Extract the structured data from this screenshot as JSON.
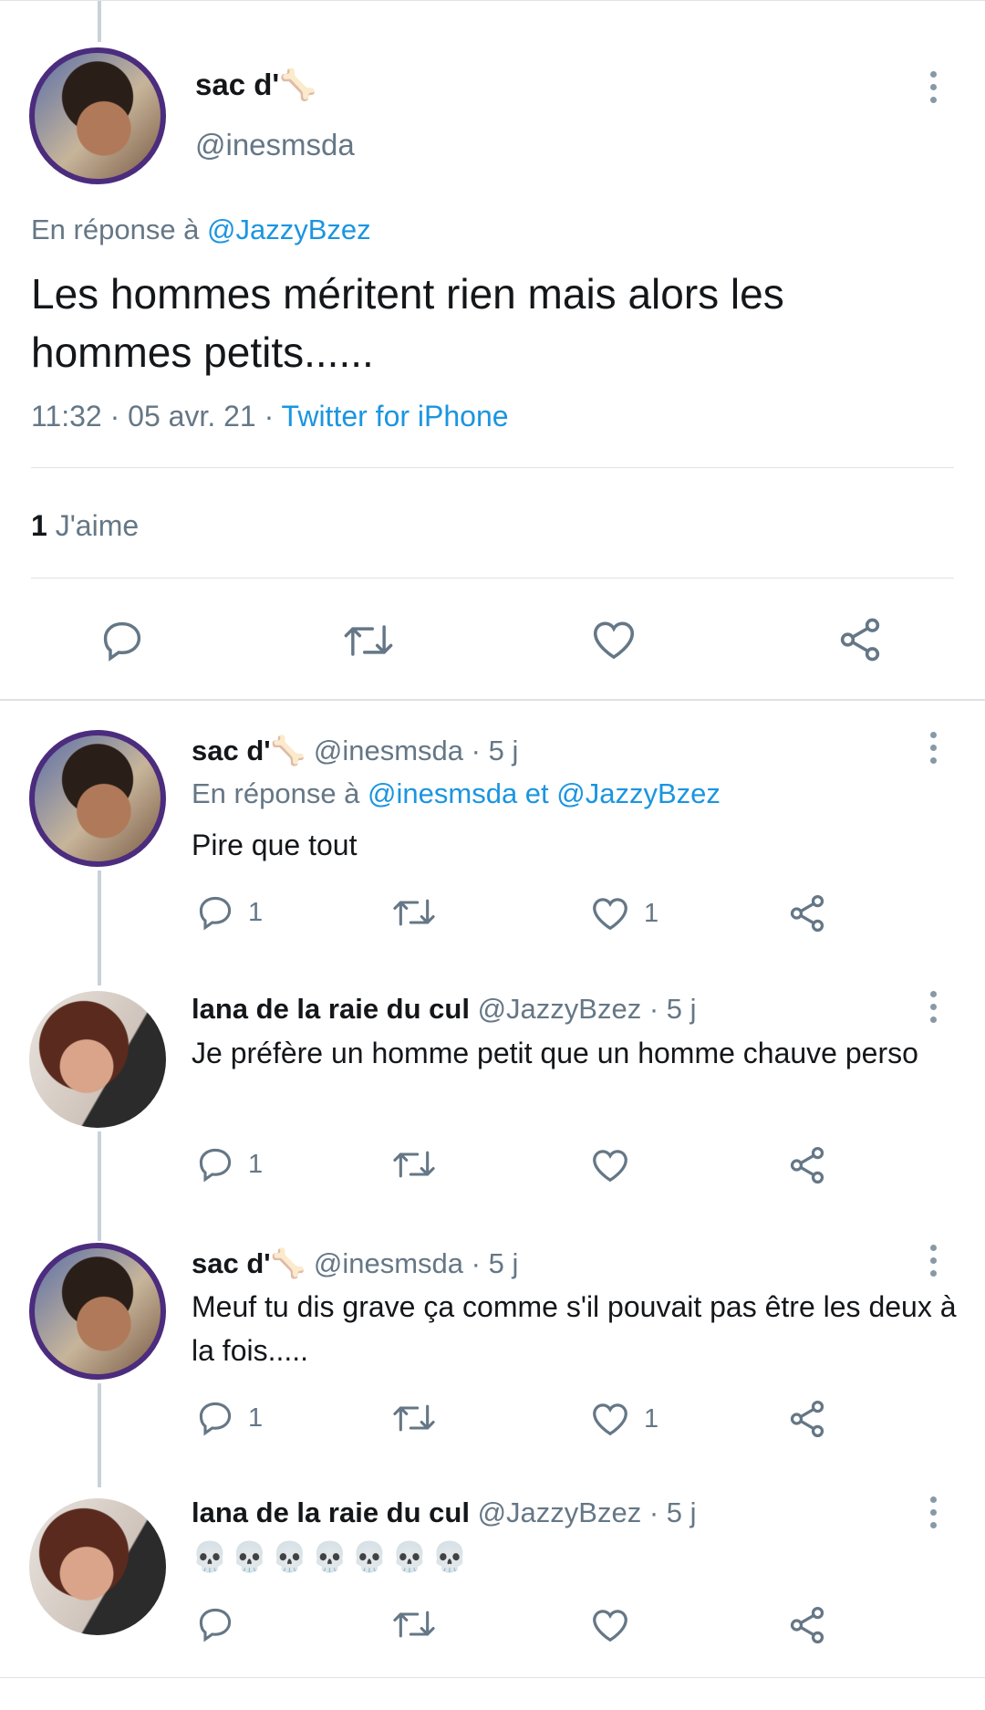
{
  "main_tweet": {
    "name": "sac d'",
    "name_emoji": "🦴",
    "handle": "@inesmsda",
    "reply_prefix": "En réponse à",
    "reply_to": "@JazzyBzez",
    "text": "Les hommes méritent rien mais alors les hommes petits......",
    "time_date": "11:32 · 05 avr. 21 ·",
    "source": "Twitter for iPhone",
    "likes_count": "1",
    "likes_label": "J'aime"
  },
  "replies": [
    {
      "name": "sac d'",
      "name_emoji": "🦴",
      "handle": "@inesmsda",
      "time": "· 5 j",
      "reply_prefix": "En réponse à",
      "reply_to": "@inesmsda et @JazzyBzez",
      "text": "Pire que tout",
      "reply_count": "1",
      "retweet_count": "",
      "like_count": "1"
    },
    {
      "name": "lana de la raie du cul",
      "name_emoji": "",
      "handle": "@JazzyBzez",
      "time": "· 5 j",
      "text": "Je préfère un homme petit que un homme chauve perso",
      "reply_count": "1",
      "retweet_count": "",
      "like_count": ""
    },
    {
      "name": "sac d'",
      "name_emoji": "🦴",
      "handle": "@inesmsda",
      "time": "· 5 j",
      "text": "Meuf tu dis grave ça comme s'il pouvait pas être les deux à la fois.....",
      "reply_count": "1",
      "retweet_count": "",
      "like_count": "1"
    },
    {
      "name": "lana de la raie du cul",
      "name_emoji": "",
      "handle": "@JazzyBzez",
      "time": "· 5 j",
      "text": "💀💀💀💀💀💀💀",
      "reply_count": "",
      "retweet_count": "",
      "like_count": ""
    }
  ],
  "icons": [
    "reply-icon",
    "retweet-icon",
    "like-icon",
    "share-icon",
    "more-icon"
  ],
  "colors": {
    "link": "#1b95e0",
    "secondary": "#657786",
    "text": "#14171a",
    "separator": "#dfe3e6"
  }
}
